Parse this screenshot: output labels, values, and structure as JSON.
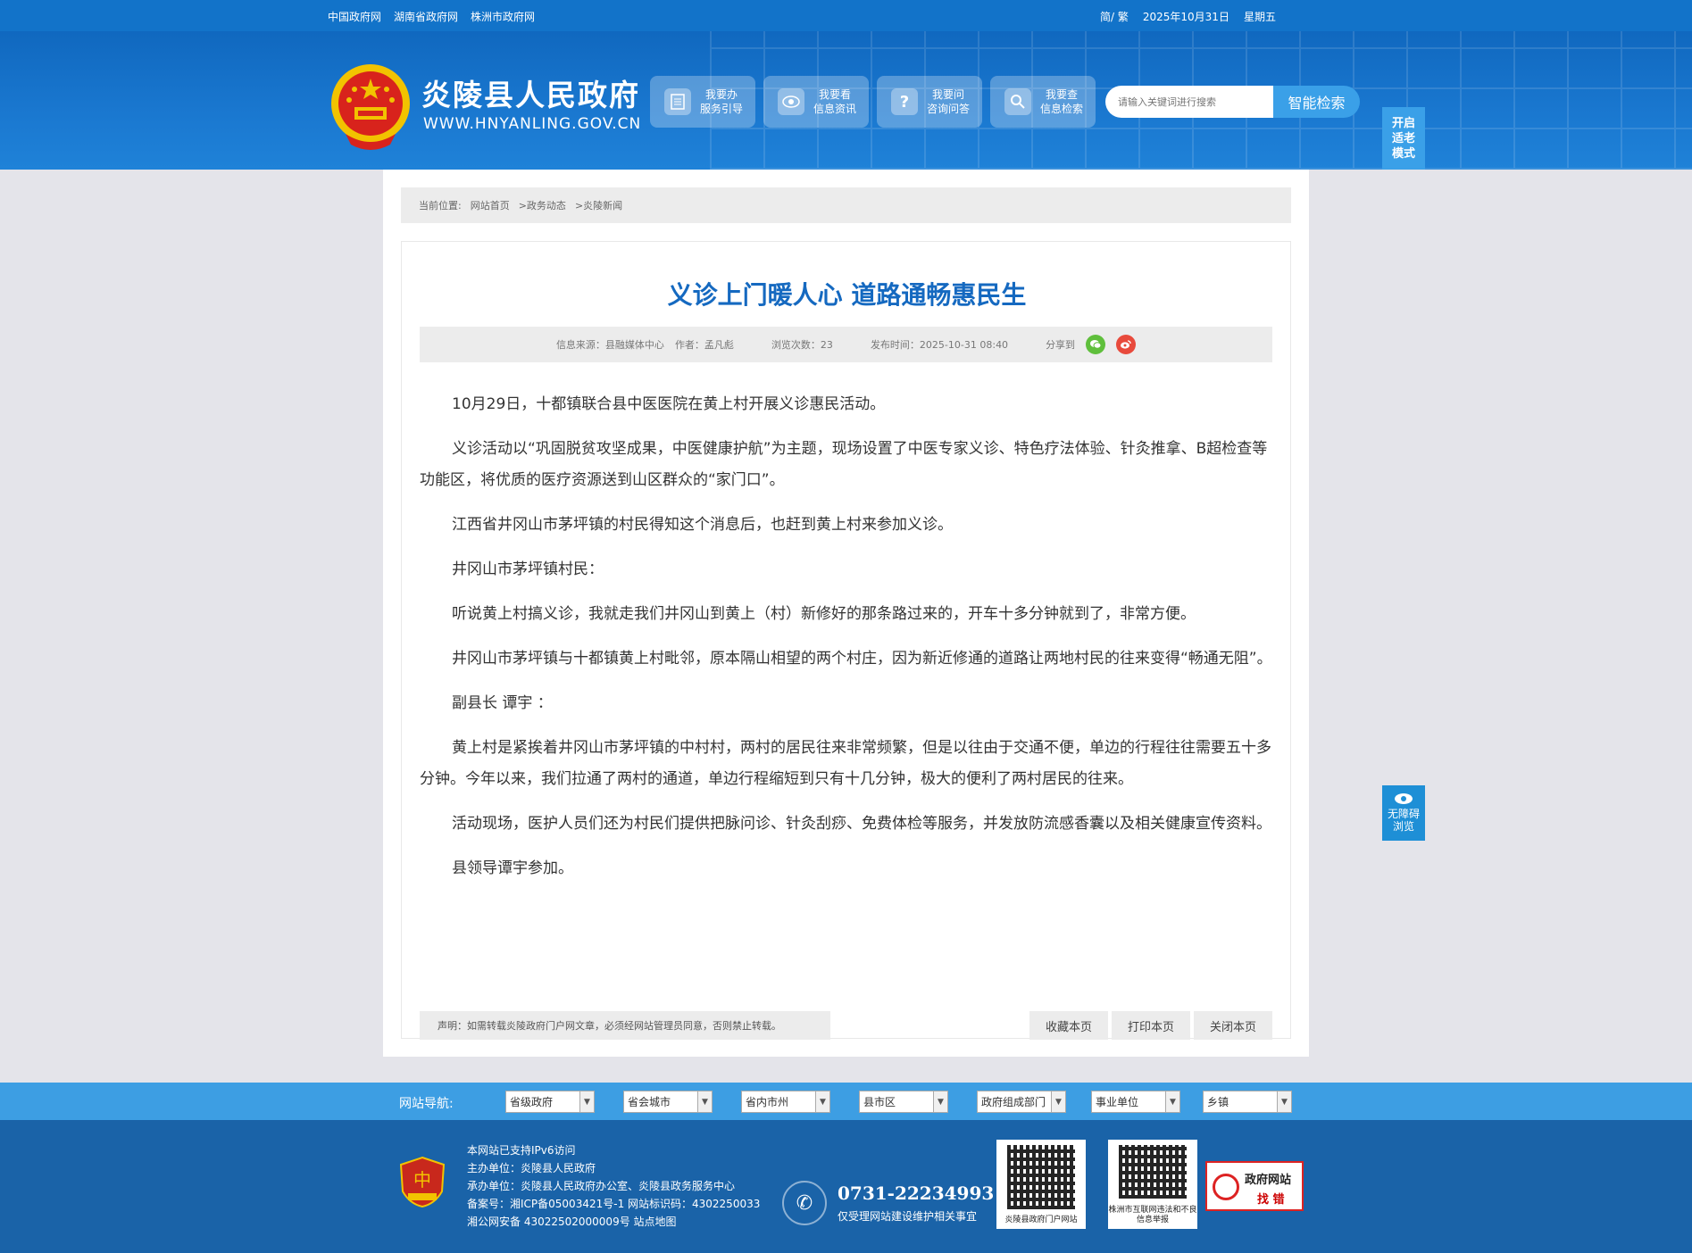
{
  "topbar": {
    "links": [
      "中国政府网",
      "湖南省政府网",
      "株洲市政府网"
    ],
    "lang": "简/ 繁",
    "date": "2025年10月31日",
    "weekday": "星期五"
  },
  "header": {
    "title": "炎陵县人民政府",
    "domain": "WWW.HNYANLING.GOV.CN",
    "services": [
      {
        "line1": "我要办",
        "line2": "服务引导",
        "icon": "document-icon"
      },
      {
        "line1": "我要看",
        "line2": "信息资讯",
        "icon": "eye-icon"
      },
      {
        "line1": "我要问",
        "line2": "咨询问答",
        "icon": "question-icon"
      },
      {
        "line1": "我要查",
        "line2": "信息检索",
        "icon": "search-icon"
      }
    ],
    "search_placeholder": "请输入关键词进行搜索",
    "search_button": "智能检索",
    "elder_mode": "开启适老模式"
  },
  "breadcrumb": {
    "prefix": "当前位置:",
    "items": [
      "网站首页",
      ">政务动态",
      ">炎陵新闻"
    ]
  },
  "article": {
    "title": "义诊上门暖人心 道路通畅惠民生",
    "meta": {
      "source": "信息来源：县融媒体中心",
      "author": "作者：孟凡彪",
      "views": "浏览次数：23",
      "published": "发布时间：2025-10-31 08:40",
      "share": "分享到"
    },
    "paragraphs": [
      "10月29日，十都镇联合县中医医院在黄上村开展义诊惠民活动。",
      "义诊活动以“巩固脱贫攻坚成果，中医健康护航”为主题，现场设置了中医专家义诊、特色疗法体验、针灸推拿、B超检查等功能区，将优质的医疗资源送到山区群众的“家门口”。",
      "江西省井冈山市茅坪镇的村民得知这个消息后，也赶到黄上村来参加义诊。",
      "井冈山市茅坪镇村民：",
      "听说黄上村搞义诊，我就走我们井冈山到黄上（村）新修好的那条路过来的，开车十多分钟就到了，非常方便。",
      "井冈山市茅坪镇与十都镇黄上村毗邻，原本隔山相望的两个村庄，因为新近修通的道路让两地村民的往来变得“畅通无阻”。",
      "副县长 谭宇 ：",
      "黄上村是紧挨着井冈山市茅坪镇的中村村，两村的居民往来非常频繁，但是以往由于交通不便，单边的行程往往需要五十多分钟。今年以来，我们拉通了两村的通道，单边行程缩短到只有十几分钟，极大的便利了两村居民的往来。",
      "活动现场，医护人员们还为村民们提供把脉问诊、针灸刮痧、免费体检等服务，并发放防流感香囊以及相关健康宣传资料。",
      "县领导谭宇参加。"
    ],
    "notice": "声明：如需转载炎陵政府门户网文章，必须经网站管理员同意，否则禁止转载。",
    "tools": [
      "收藏本页",
      "打印本页",
      "关闭本页"
    ]
  },
  "accessibility": {
    "line1": "无障碍",
    "line2": "浏览"
  },
  "site_nav": {
    "label": "网站导航:",
    "selects": [
      "省级政府",
      "省会城市",
      "省内市州",
      "县市区",
      "政府组成部门",
      "事业单位",
      "乡镇"
    ]
  },
  "footer": {
    "lines": [
      "本网站已支持IPv6访问",
      "主办单位：炎陵县人民政府",
      "承办单位：炎陵县人民政府办公室、炎陵县政务服务中心",
      "备案号：湘ICP备05003421号-1 网站标识码：4302250033",
      "湘公网安备 43022502000009号 站点地图"
    ],
    "phone": "0731-22234993",
    "phone_note": "仅受理网站建设维护相关事宜",
    "qr1_caption": "炎陵县政府门户网站",
    "qr2_caption": "株洲市互联网违法和不良信息举报",
    "fix_line1": "政府网站",
    "fix_line2": "找 错"
  },
  "colors": {
    "brand_blue": "#1273c9",
    "title_blue": "#1569c0",
    "nav_blue": "#3d9ee3",
    "footer_blue": "#1a63a8"
  }
}
